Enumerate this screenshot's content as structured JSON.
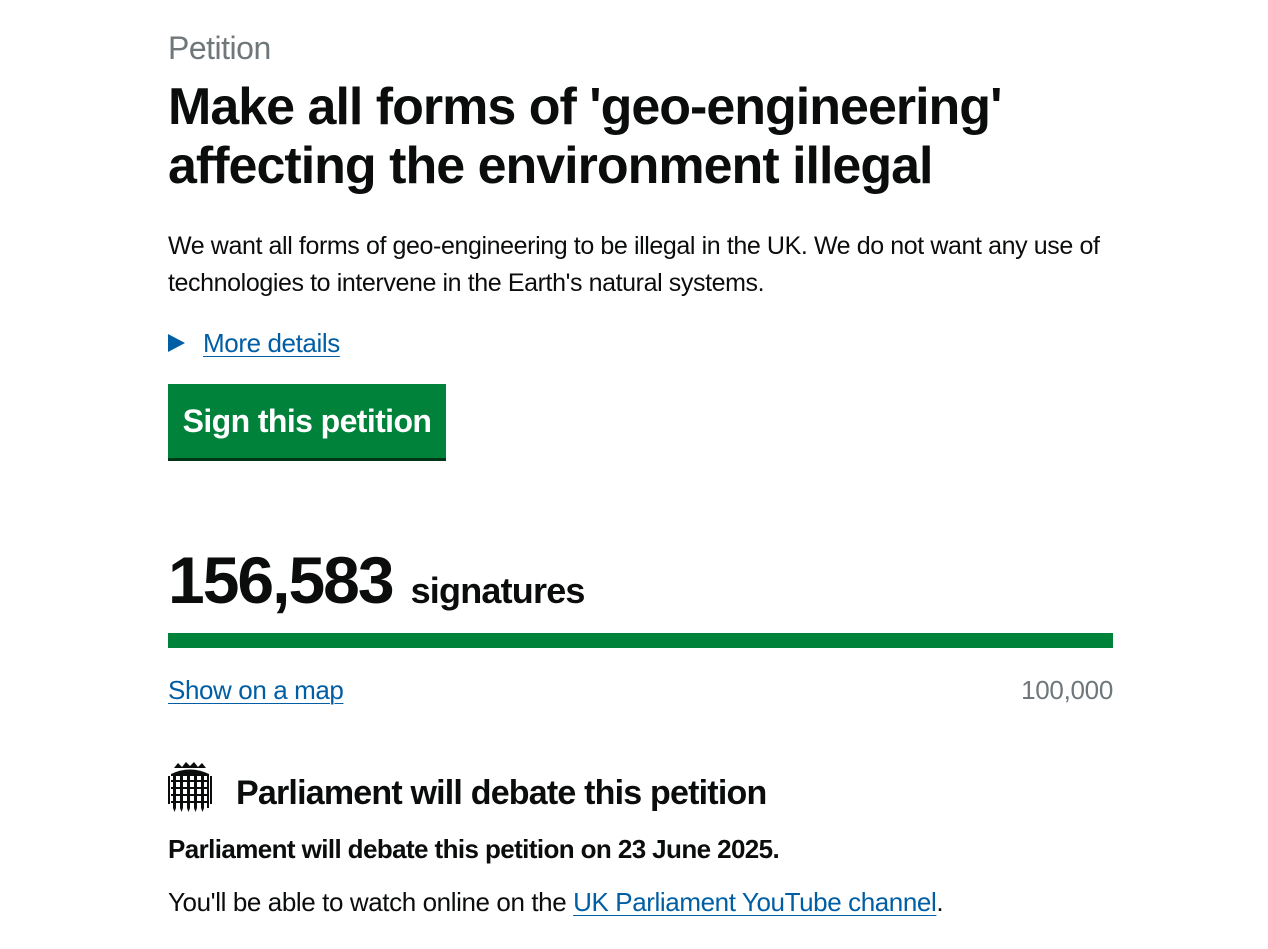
{
  "petition": {
    "caption": "Petition",
    "title": "Make all forms of 'geo-engineering' affecting the environment illegal",
    "summary": "We want all forms of geo-engineering to be illegal in the UK. We do not want any use of technologies to intervene in the Earth's natural systems.",
    "more_details_label": "More details",
    "sign_button_label": "Sign this petition"
  },
  "signatures": {
    "count": "156,583",
    "label": "signatures",
    "threshold": "100,000",
    "progress_percent": 100,
    "show_map_label": "Show on a map"
  },
  "debate": {
    "heading": "Parliament will debate this petition",
    "date_text": "Parliament will debate this petition on 23 June 2025.",
    "watch_prefix": "You'll be able to watch online on the ",
    "watch_link": "UK Parliament YouTube channel",
    "watch_suffix": "."
  },
  "colors": {
    "accent_green": "#00823b",
    "link_blue": "#005ea5",
    "secondary_text": "#6f777b"
  },
  "icons": {
    "details_toggle": "triangle-right-icon",
    "debate": "portcullis-icon"
  }
}
